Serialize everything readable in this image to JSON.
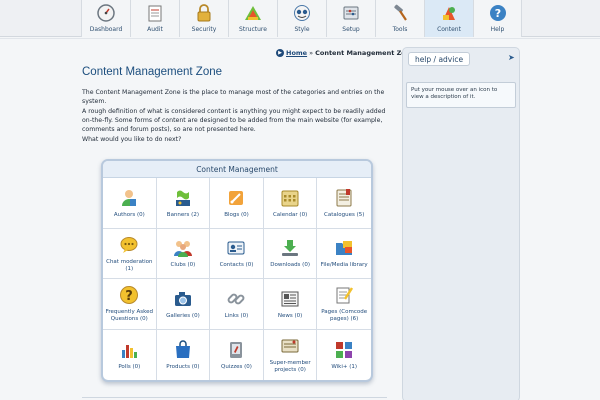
{
  "nav": {
    "items": [
      {
        "label": "Dashboard",
        "icon": "dashboard-icon"
      },
      {
        "label": "Audit",
        "icon": "audit-icon"
      },
      {
        "label": "Security",
        "icon": "lock-icon"
      },
      {
        "label": "Structure",
        "icon": "structure-icon"
      },
      {
        "label": "Style",
        "icon": "style-icon"
      },
      {
        "label": "Setup",
        "icon": "setup-icon"
      },
      {
        "label": "Tools",
        "icon": "hammer-icon"
      },
      {
        "label": "Content",
        "icon": "content-icon"
      },
      {
        "label": "Help",
        "icon": "help-icon"
      }
    ],
    "active": "Content"
  },
  "breadcrumb": {
    "home": "Home",
    "separator": "»",
    "current": "Content Management Zone"
  },
  "main": {
    "title": "Content Management Zone",
    "p1": "The Content Management Zone is the place to manage most of the categories and entries on the system.",
    "p2": "A rough definition of what is considered content is anything you might expect to be readily added on-the-fly. Some forms of content are designed to be added from the main website (for example, comments and forum posts), so are not presented here.",
    "p3": "What would you like to do next?"
  },
  "panel": {
    "title": "Content Management",
    "items": [
      {
        "label": "Authors (0)",
        "icon": "authors-icon"
      },
      {
        "label": "Banners (2)",
        "icon": "banners-icon"
      },
      {
        "label": "Blogs (0)",
        "icon": "blogs-icon"
      },
      {
        "label": "Calendar (0)",
        "icon": "calendar-icon"
      },
      {
        "label": "Catalogues (5)",
        "icon": "catalogues-icon"
      },
      {
        "label": "Chat moderation (1)",
        "icon": "chat-icon"
      },
      {
        "label": "Clubs (0)",
        "icon": "clubs-icon"
      },
      {
        "label": "Contacts (0)",
        "icon": "contacts-icon"
      },
      {
        "label": "Downloads (0)",
        "icon": "downloads-icon"
      },
      {
        "label": "File/Media library",
        "icon": "media-library-icon"
      },
      {
        "label": "Frequently Asked Questions (0)",
        "icon": "faq-icon"
      },
      {
        "label": "Galleries (0)",
        "icon": "galleries-icon"
      },
      {
        "label": "Links (0)",
        "icon": "links-icon"
      },
      {
        "label": "News (0)",
        "icon": "news-icon"
      },
      {
        "label": "Pages (Comcode pages) (6)",
        "icon": "pages-icon"
      },
      {
        "label": "Polls (0)",
        "icon": "polls-icon"
      },
      {
        "label": "Products (0)",
        "icon": "products-icon"
      },
      {
        "label": "Quizzes (0)",
        "icon": "quizzes-icon"
      },
      {
        "label": "Super-member projects (0)",
        "icon": "projects-icon"
      },
      {
        "label": "Wiki+ (1)",
        "icon": "wiki-icon"
      }
    ]
  },
  "sidebar": {
    "help_tab": "help / advice",
    "help_text": "Put your mouse over an icon to view a description of it."
  },
  "colors": {
    "accent": "#1c4e7e",
    "active_tab": "#dbe9f6",
    "panel_border": "#b8c9dd"
  }
}
